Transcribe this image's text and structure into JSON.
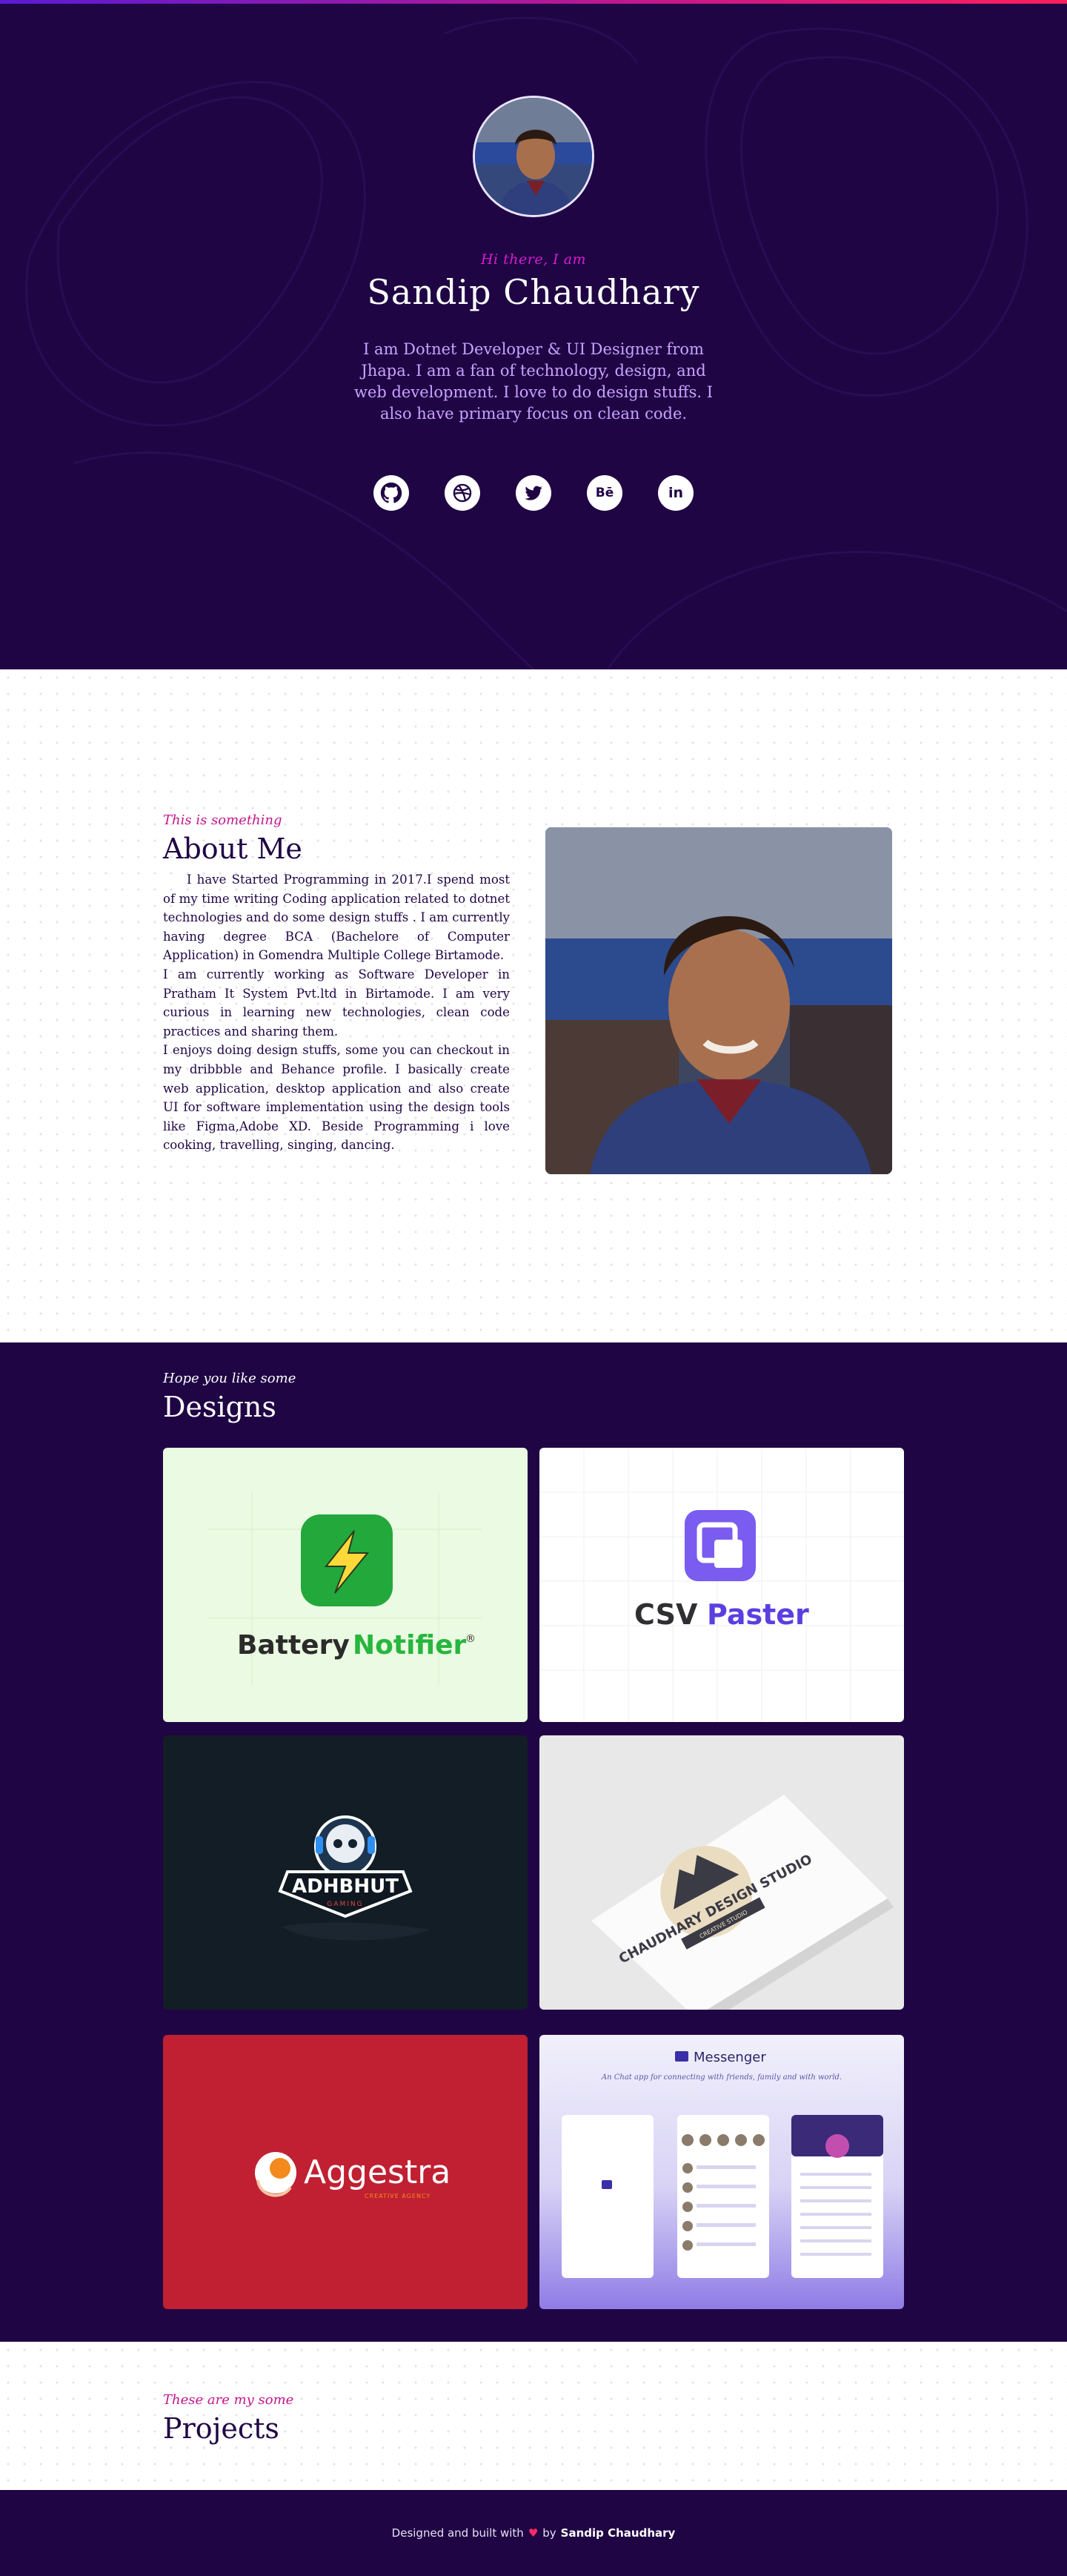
{
  "colors": {
    "hero_bg": "#1f0544",
    "accent_pink": "#c2188d",
    "accent_magenta": "#d81bd0",
    "desc_purple": "#c9a2ff"
  },
  "hero": {
    "greeting": "Hi there, I am",
    "name": "Sandip Chaudhary",
    "description": "I am Dotnet Developer & UI Designer from Jhapa. I am a fan of technology, design, and web development. I love to do design stuffs. I also have primary focus on clean code.",
    "socials": [
      {
        "name": "github",
        "icon": "github-icon"
      },
      {
        "name": "dribbble",
        "icon": "dribbble-icon"
      },
      {
        "name": "twitter",
        "icon": "twitter-icon"
      },
      {
        "name": "behance",
        "icon": "behance-icon",
        "glyph": "Bē"
      },
      {
        "name": "linkedin",
        "icon": "linkedin-icon",
        "glyph": "in"
      }
    ]
  },
  "about": {
    "eyebrow": "This is something",
    "title": "About Me",
    "paragraphs": [
      "I have Started Programming in 2017.I spend most of my time writing Coding application related to dotnet technologies and do some design stuffs . I am currently having degree BCA (Bachelore of Computer Application) in Gomendra Multiple College Birtamode.",
      "I am currently working as Software Developer in Pratham It System Pvt.ltd in Birtamode. I am very curious in learning new technologies, clean code practices and sharing them.",
      "I enjoys doing design stuffs, some you can checkout in my dribbble and Behance profile. I basically create web application, desktop application and also create UI for software implementation using the design tools like Figma,Adobe XD. Beside Programming i love cooking, travelling, singing, dancing."
    ]
  },
  "designs": {
    "eyebrow": "Hope you like some",
    "title": "Designs",
    "cards": [
      {
        "id": "battery",
        "word1": "Battery",
        "word2": "Notifier",
        "mark": "®"
      },
      {
        "id": "csv",
        "word1": "CSV",
        "word2": "Paster"
      },
      {
        "id": "adhbhut",
        "word1": "ADHBHUT",
        "word2": "GAMING"
      },
      {
        "id": "chaudhary",
        "word1": "CHAUDHARY DESIGN STUDIO",
        "word2": "CREATIVE STUDIO"
      },
      {
        "id": "aggestra",
        "word1": "Aggestra",
        "word2": "CREATIVE AGENCY"
      },
      {
        "id": "messenger",
        "word1": "Messenger",
        "word2": "An Chat app for connecting with friends, family and with world."
      }
    ]
  },
  "projects": {
    "eyebrow": "These are my some",
    "title": "Projects"
  },
  "footer": {
    "prefix": "Designed and built with",
    "heart": "♥",
    "by": "by",
    "author": "Sandip Chaudhary"
  }
}
